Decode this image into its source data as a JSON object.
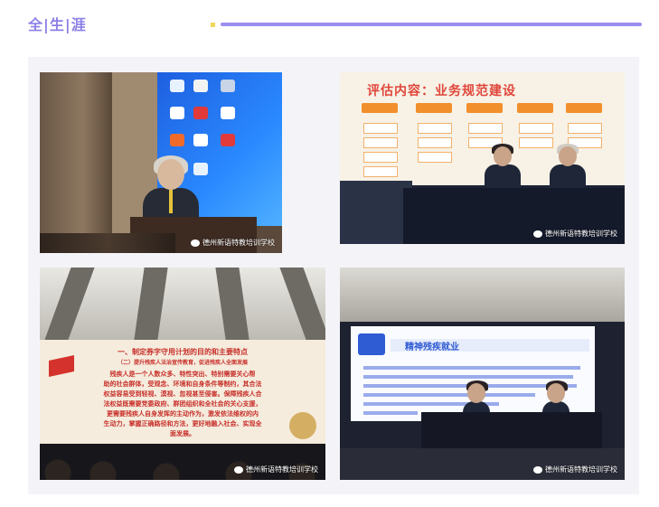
{
  "header": {
    "title": "全|生|涯"
  },
  "colors": {
    "title": "#8b7fe6",
    "accent_bar": "#9b8ff0",
    "accent_dot": "#f2d65a",
    "panel_bg": "#f4f4f8"
  },
  "photos": [
    {
      "watermark": "德州新语特教培训学校"
    },
    {
      "watermark": "德州新语特教培训学校",
      "screen_title": "评估内容：业务规范建设"
    },
    {
      "watermark": "德州新语特教培训学校",
      "screen_heading": "一、制定券字守用计划的目的和主要特点",
      "screen_subheading": "（二）提升残疾人法治宣传教育，促进残疾人全面发展",
      "screen_body": [
        "残疾人是一个人数众多、特性突出、特别需要关心帮",
        "助的社会群体，受观念、环境和自身条件等制约，其合法",
        "权益容易受到轻视、漠视、忽视甚至侵害。保障残疾人合",
        "法权益既需要党委政府、群团组织和全社会的关心支援，",
        "更需要残疾人自身发挥的主动作为，激发依法维权的内",
        "生动力，掌握正确路径和方法，更好地融入社会、实现全",
        "面发展。"
      ]
    },
    {
      "watermark": "德州新语特教培训学校",
      "screen_title": "精神残疾就业"
    }
  ]
}
